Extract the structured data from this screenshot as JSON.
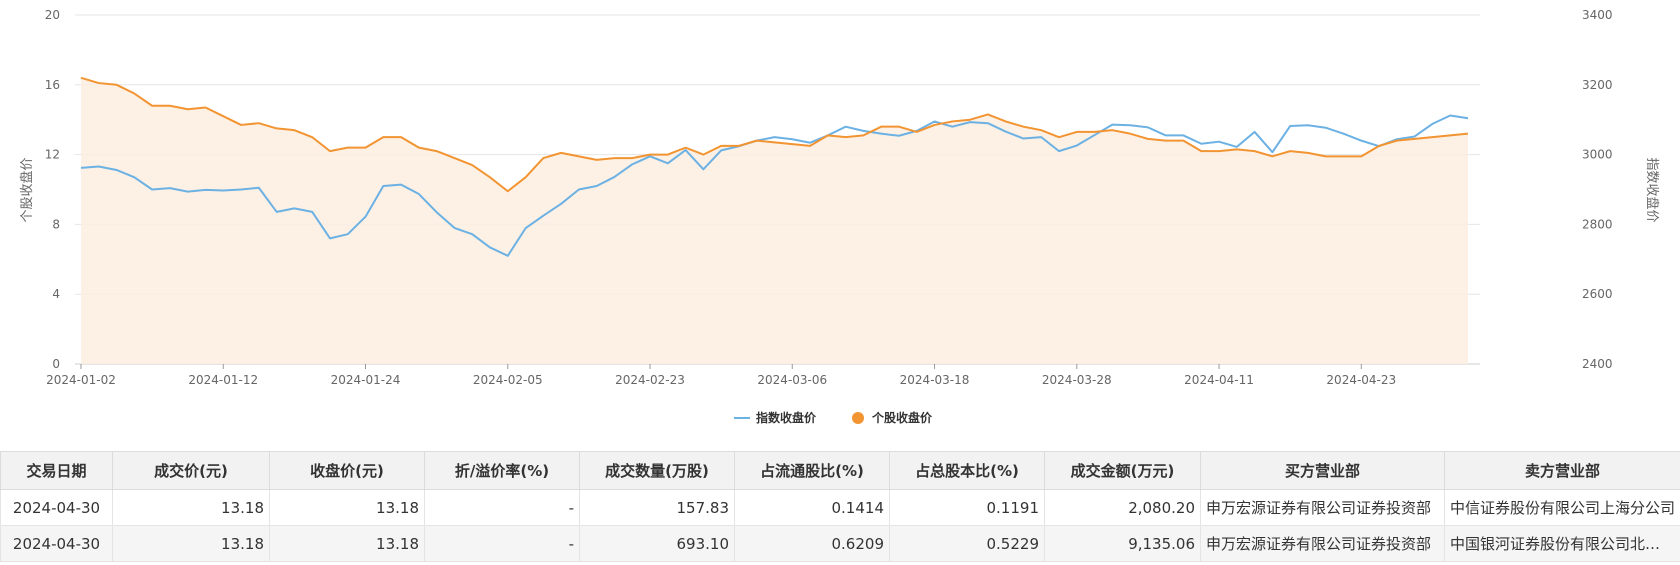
{
  "chart_data": {
    "type": "line",
    "y_left": {
      "label": "个股收盘价",
      "min": 0,
      "max": 20,
      "ticks": [
        0,
        4,
        8,
        12,
        16,
        20
      ]
    },
    "y_right": {
      "label": "指数收盘价",
      "min": 2400,
      "max": 3400,
      "ticks": [
        2400,
        2600,
        2800,
        3000,
        3200,
        3400
      ]
    },
    "x_tick_labels": [
      "2024-01-02",
      "2024-01-12",
      "2024-01-24",
      "2024-02-05",
      "2024-02-23",
      "2024-03-06",
      "2024-03-18",
      "2024-03-28",
      "2024-04-11",
      "2024-04-23"
    ],
    "x_tick_index": [
      0,
      8,
      16,
      24,
      32,
      40,
      48,
      56,
      64,
      72
    ],
    "grid": true,
    "legend_position": "bottom",
    "series": [
      {
        "name": "指数收盘价",
        "axis": "right",
        "color": "#6cb1e3",
        "values": [
          2962,
          2966,
          2956,
          2935,
          2900,
          2904,
          2894,
          2899,
          2897,
          2900,
          2905,
          2836,
          2846,
          2836,
          2760,
          2772,
          2822,
          2910,
          2914,
          2887,
          2835,
          2790,
          2772,
          2734,
          2710,
          2789,
          2825,
          2859,
          2900,
          2910,
          2936,
          2972,
          2995,
          2975,
          3013,
          2958,
          3012,
          3024,
          3040,
          3050,
          3044,
          3034,
          3055,
          3080,
          3068,
          3060,
          3054,
          3068,
          3095,
          3080,
          3093,
          3090,
          3066,
          3046,
          3050,
          3010,
          3026,
          3056,
          3086,
          3084,
          3078,
          3055,
          3055,
          3031,
          3037,
          3022,
          3065,
          3007,
          3082,
          3084,
          3077,
          3060,
          3040,
          3024,
          3044,
          3052,
          3088,
          3112,
          3104
        ]
      },
      {
        "name": "个股收盘价",
        "axis": "left",
        "color": "#f29432",
        "values": [
          16.4,
          16.1,
          16.0,
          15.5,
          14.8,
          14.8,
          14.6,
          14.7,
          14.2,
          13.7,
          13.8,
          13.5,
          13.4,
          13.0,
          12.2,
          12.4,
          12.4,
          13.0,
          13.0,
          12.4,
          12.2,
          11.8,
          11.4,
          10.7,
          9.9,
          10.7,
          11.8,
          12.1,
          11.9,
          11.7,
          11.8,
          11.8,
          12.0,
          12.0,
          12.4,
          12.0,
          12.5,
          12.5,
          12.8,
          12.7,
          12.6,
          12.5,
          13.1,
          13.0,
          13.1,
          13.6,
          13.6,
          13.3,
          13.7,
          13.9,
          14.0,
          14.3,
          13.9,
          13.6,
          13.4,
          13.0,
          13.3,
          13.3,
          13.4,
          13.2,
          12.9,
          12.8,
          12.8,
          12.2,
          12.2,
          12.3,
          12.2,
          11.9,
          12.2,
          12.1,
          11.9,
          11.9,
          11.9,
          12.5,
          12.8,
          12.9,
          13.0,
          13.1,
          13.2
        ]
      }
    ]
  },
  "table": {
    "headers": [
      "交易日期",
      "成交价(元)",
      "收盘价(元)",
      "折/溢价率(%)",
      "成交数量(万股)",
      "占流通股比(%)",
      "占总股本比(%)",
      "成交金额(万元)",
      "买方营业部",
      "卖方营业部"
    ],
    "rows": [
      [
        "2024-04-30",
        "13.18",
        "13.18",
        "-",
        "157.83",
        "0.1414",
        "0.1191",
        "2,080.20",
        "申万宏源证券有限公司证券投资部",
        "中信证券股份有限公司上海分公司"
      ],
      [
        "2024-04-30",
        "13.18",
        "13.18",
        "-",
        "693.10",
        "0.6209",
        "0.5229",
        "9,135.06",
        "申万宏源证券有限公司证券投资部",
        "中国银河证券股份有限公司北京中关村大街证券营业部"
      ]
    ]
  }
}
